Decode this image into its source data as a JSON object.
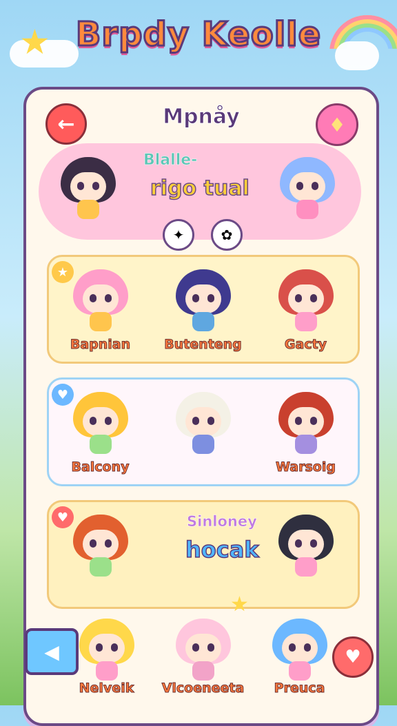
{
  "game_title": "Brpdy Keolle",
  "header": {
    "title": "Mpnåy",
    "back_icon": "arrow-left-icon",
    "gift_icon": "gift-icon"
  },
  "featured": {
    "subtitle": "Blalle-",
    "title": "rigo tual"
  },
  "rows": [
    {
      "characters": [
        {
          "name": "Bapnian"
        },
        {
          "name": "Butenteng"
        },
        {
          "name": "Gacty"
        }
      ]
    },
    {
      "characters": [
        {
          "name": "Balcony"
        },
        {
          "name": ""
        },
        {
          "name": "Warsoig"
        }
      ]
    }
  ],
  "mid_card": {
    "subtitle": "Sinloney",
    "title": "hocak"
  },
  "bottom_row": {
    "characters": [
      {
        "name": "Nelveik"
      },
      {
        "name": "Vlcoeneeta"
      },
      {
        "name": "Preuca"
      }
    ]
  },
  "colors": {
    "panel_border": "#6b4a86",
    "accent_pink": "#ff7bb6",
    "accent_orange": "#ff7a3d"
  }
}
